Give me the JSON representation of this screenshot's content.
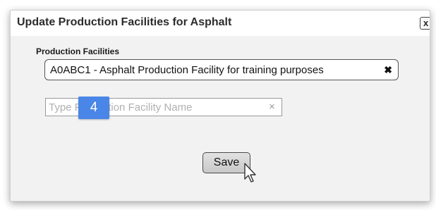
{
  "dialog": {
    "title": "Update Production Facilities for Asphalt",
    "close_label": "x"
  },
  "form": {
    "field_label": "Production Facilities",
    "selected_item": "A0ABC1 - Asphalt Production Facility for training purposes",
    "remove_icon": "✖",
    "search_placeholder": "Type Production Facility Name",
    "clear_icon": "×",
    "save_label": "Save"
  },
  "annotation": {
    "step_number": "4",
    "color": "#4a86e8"
  }
}
